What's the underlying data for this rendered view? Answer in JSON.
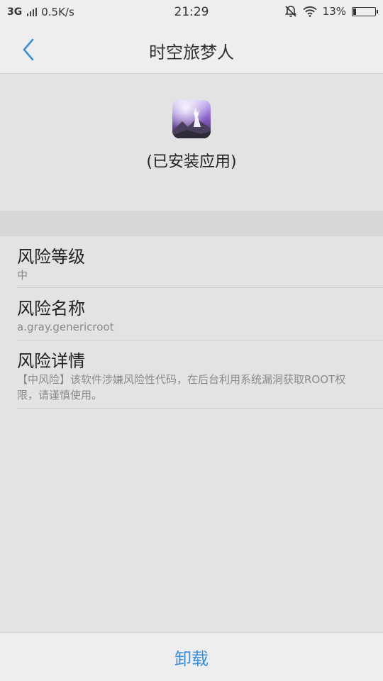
{
  "status_bar": {
    "network": "3G",
    "speed": "0.5K/s",
    "time": "21:29",
    "battery_text": "13%",
    "battery_level": 0.13,
    "icons": [
      "signal-icon",
      "mute-icon",
      "wifi-icon",
      "battery-icon"
    ]
  },
  "nav": {
    "title": "时空旅梦人",
    "back_icon": "chevron-left-icon",
    "accent": "#3a8fd6"
  },
  "app": {
    "icon": "app-icon",
    "status": "(已安装应用)"
  },
  "risk": {
    "level_title": "风险等级",
    "level_value": "中",
    "name_title": "风险名称",
    "name_value": "a.gray.genericroot",
    "detail_title": "风险详情",
    "detail_value": "【中风险】该软件涉嫌风险性代码，在后台利用系统漏洞获取ROOT权限，请谨慎使用。"
  },
  "actions": {
    "uninstall_label": "卸载"
  }
}
